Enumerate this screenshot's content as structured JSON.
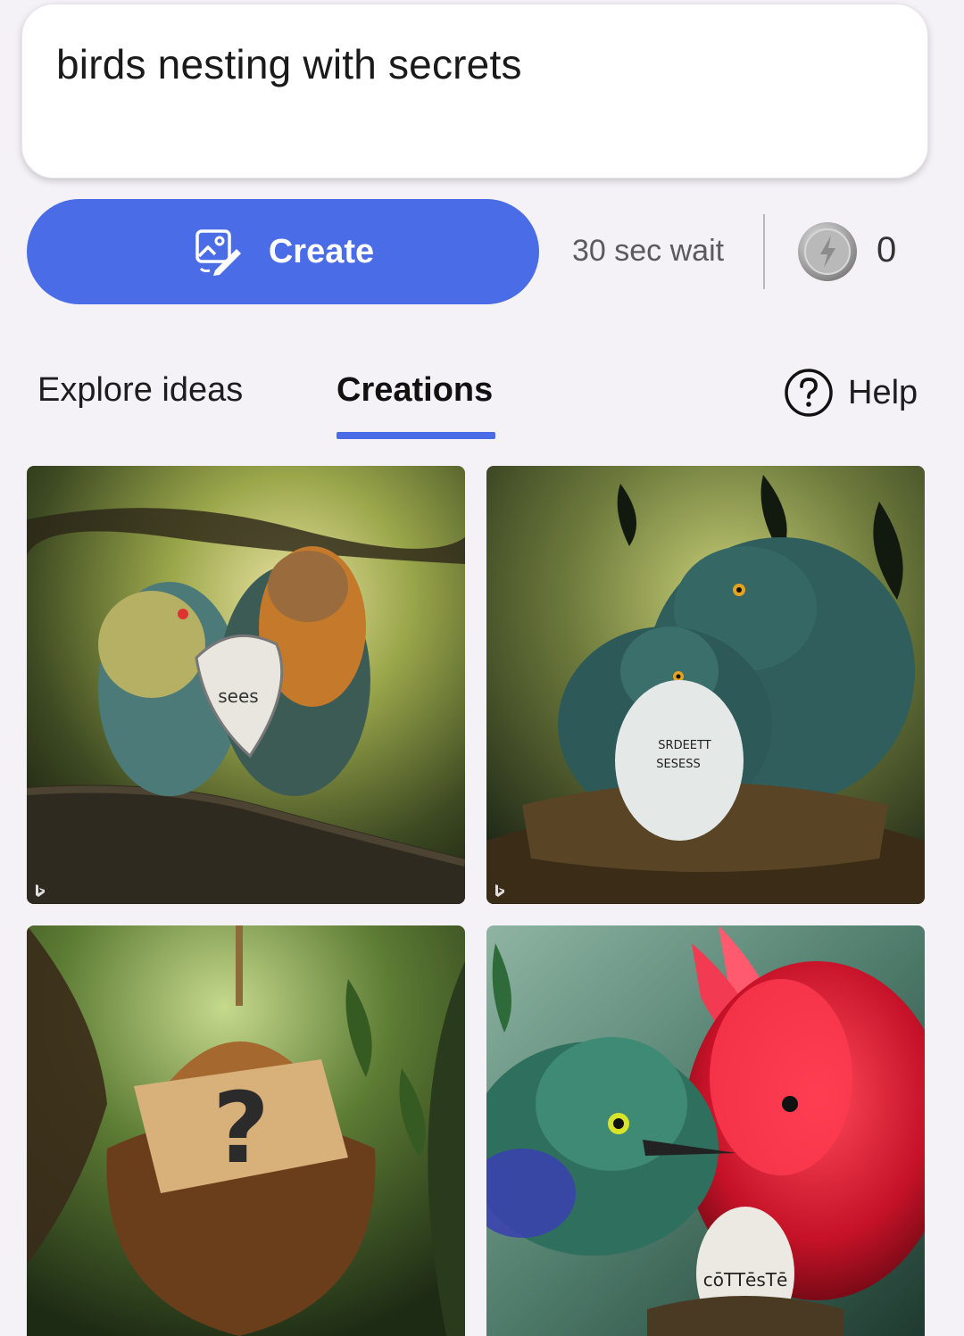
{
  "prompt": {
    "text": "birds nesting with secrets"
  },
  "actions": {
    "create_label": "Create",
    "wait_text": "30 sec wait",
    "boost_count": "0"
  },
  "tabs": [
    {
      "label": "Explore ideas",
      "active": false
    },
    {
      "label": "Creations",
      "active": true
    }
  ],
  "help": {
    "label": "Help"
  },
  "images": [
    {
      "id": "creation-1",
      "egg_text": "sees"
    },
    {
      "id": "creation-2",
      "egg_text_line1": "SRDEETT",
      "egg_text_line2": "SESESS"
    },
    {
      "id": "creation-3",
      "mark": "?"
    },
    {
      "id": "creation-4",
      "egg_text": "cōTTēsTē"
    }
  ],
  "colors": {
    "accent": "#4a6ce6",
    "background": "#f4f2f7",
    "tab_underline": "#4a6ce6"
  },
  "icons": {
    "create": "image-pen-icon",
    "boost": "lightning-coin-icon",
    "help": "question-circle-icon",
    "watermark": "bing-icon"
  }
}
